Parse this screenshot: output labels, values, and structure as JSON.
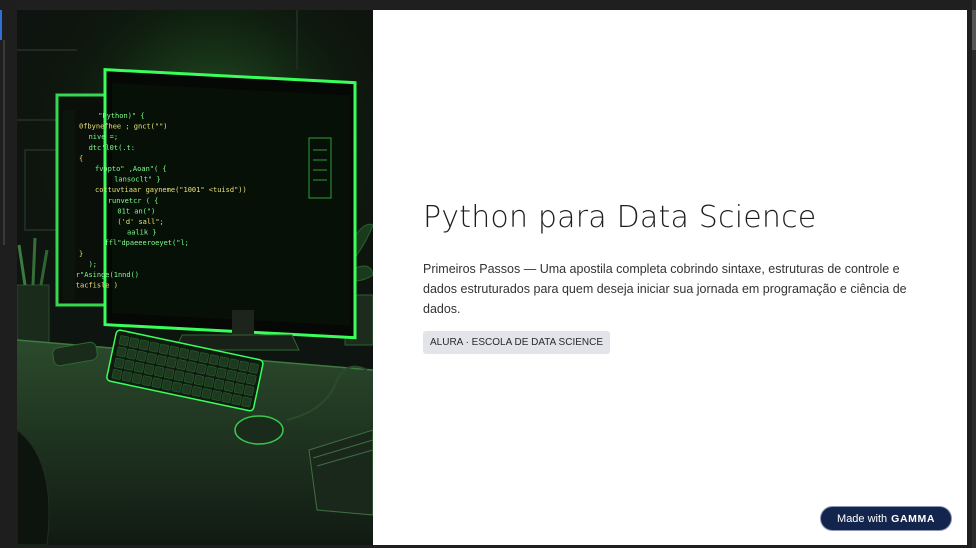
{
  "slide": {
    "title": "Python para Data Science",
    "description": "Primeiros Passos — Uma apostila completa cobrindo sintaxe, estruturas de controle e dados estruturados para quem deseja iniciar sua jornada em programação e ciência de dados.",
    "tag": "ALURA · ESCOLA DE DATA SCIENCE"
  },
  "badge": {
    "made_with": "Made with",
    "brand": "GAMMA"
  },
  "illustration": {
    "code_lines": [
      "\"Python)\" {",
      "0fbynefhee ; gnct(\"\")",
      "  nive  =;",
      "  dtc'l0t(.t:",
      "{",
      "  fvppto\" ,Aoan\"( {",
      "     lansoclt\" }",
      "  cottuvtiaar gayneme(\"1001\"  <tuisd\"))",
      "    runvetcr ( {",
      "     01t      an(\")",
      "     ('d' sall\";",
      "        aalik }",
      "  ffl\"dpaeeeroeyet(\"l;",
      "}",
      "  );",
      "r\"Asinge(1nnd()",
      "tacfisle )"
    ],
    "colors": {
      "neon": "#39ff5a",
      "code_yellow": "#e8e27a",
      "code_green": "#7dff8e",
      "desk": "#1d2a1e"
    }
  }
}
